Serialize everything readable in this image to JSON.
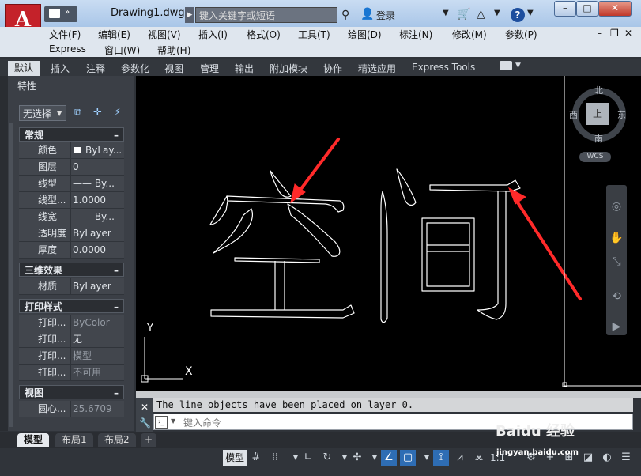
{
  "app": {
    "logo": "A",
    "doc_title": "Drawing1.dwg"
  },
  "search": {
    "placeholder": "键入关键字或短语"
  },
  "titlebar": {
    "login": "登录",
    "help": "?"
  },
  "window_controls": {
    "minimize": "–",
    "maximize": "□",
    "close": "✕"
  },
  "menu": {
    "row1": [
      "文件(F)",
      "编辑(E)",
      "视图(V)",
      "插入(I)",
      "格式(O)",
      "工具(T)",
      "绘图(D)",
      "标注(N)",
      "修改(M)",
      "参数(P)"
    ],
    "row2": [
      "Express",
      "窗口(W)",
      "帮助(H)"
    ]
  },
  "ribbon_tabs": [
    "默认",
    "插入",
    "注释",
    "参数化",
    "视图",
    "管理",
    "输出",
    "附加模块",
    "协作",
    "精选应用",
    "Express Tools"
  ],
  "properties": {
    "title": "特性",
    "selection": "无选择",
    "sections": [
      {
        "name": "常规",
        "rows": [
          {
            "k": "颜色",
            "v": "ByLay..."
          },
          {
            "k": "图层",
            "v": "0"
          },
          {
            "k": "线型",
            "v": "—— By..."
          },
          {
            "k": "线型...",
            "v": "1.0000"
          },
          {
            "k": "线宽",
            "v": "—— By..."
          },
          {
            "k": "透明度",
            "v": "ByLayer"
          },
          {
            "k": "厚度",
            "v": "0.0000"
          }
        ]
      },
      {
        "name": "三维效果",
        "rows": [
          {
            "k": "材质",
            "v": "ByLayer"
          }
        ]
      },
      {
        "name": "打印样式",
        "rows": [
          {
            "k": "打印...",
            "v": "ByColor"
          },
          {
            "k": "打印...",
            "v": "无"
          },
          {
            "k": "打印...",
            "v": "模型"
          },
          {
            "k": "打印...",
            "v": "不可用"
          }
        ]
      },
      {
        "name": "视图",
        "rows": [
          {
            "k": "圆心...",
            "v": "25.6709"
          }
        ]
      }
    ]
  },
  "viewcube": {
    "north": "北",
    "south": "南",
    "east": "东",
    "west": "西",
    "top": "上",
    "wcs": "WCS"
  },
  "ucs": {
    "x": "X",
    "y": "Y"
  },
  "command": {
    "history": "The line objects have been placed on layer 0.",
    "placeholder": "键入命令"
  },
  "layout_tabs": [
    "模型",
    "布局1",
    "布局2",
    "+"
  ],
  "status": {
    "model": "模型",
    "scale": "1:1"
  },
  "watermark": {
    "brand": "Baidu 经验",
    "url": "jingyan.baidu.com"
  },
  "colors": {
    "accent": "#2e6db4",
    "arrow": "#ff2a2a",
    "canvas": "#000000",
    "app_red": "#c4222a"
  }
}
